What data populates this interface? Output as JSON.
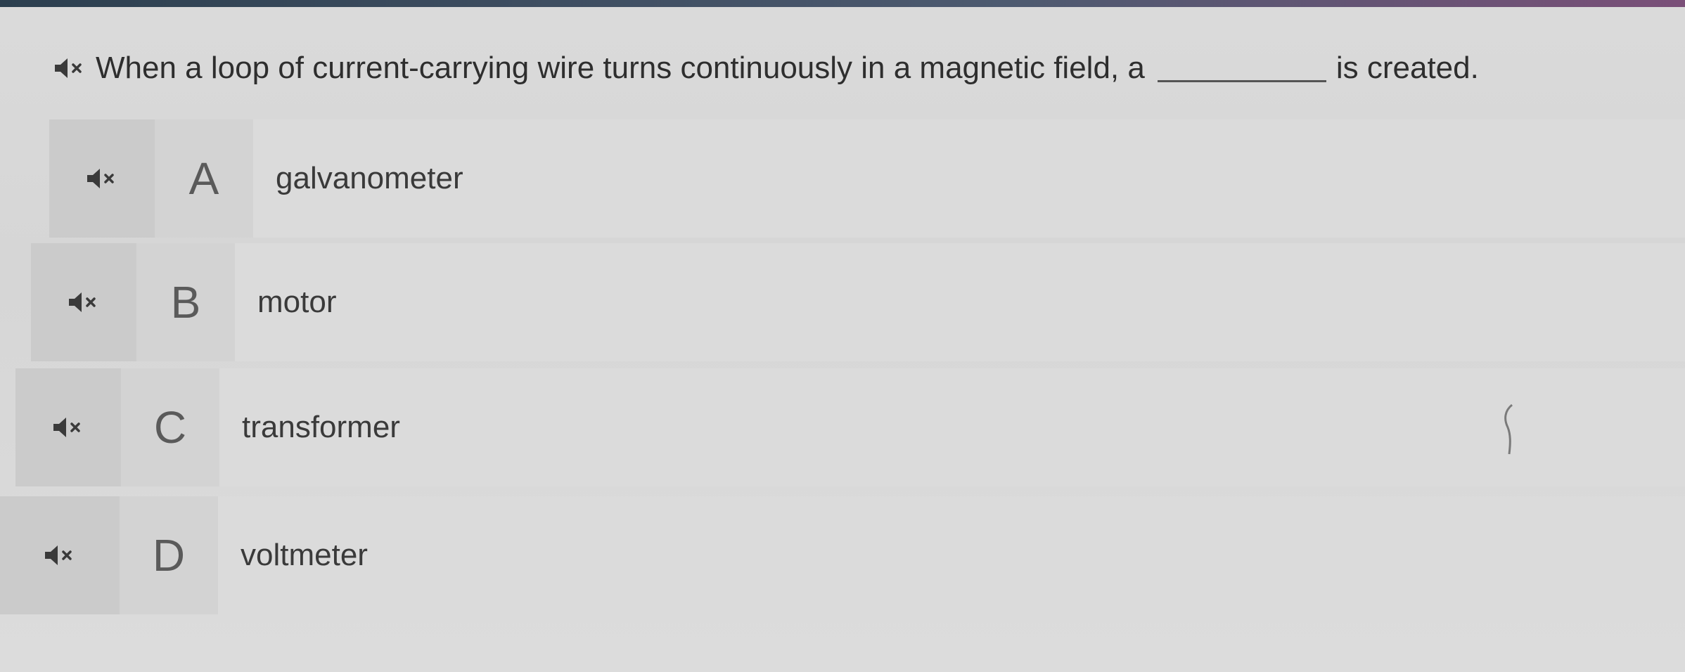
{
  "question": {
    "text_before": "When a loop of current-carrying wire turns continuously in a magnetic field, a",
    "text_after": "is created.",
    "audio_icon": "speaker-muted-icon"
  },
  "options": [
    {
      "letter": "A",
      "label": "galvanometer",
      "audio_icon": "speaker-muted-icon"
    },
    {
      "letter": "B",
      "label": "motor",
      "audio_icon": "speaker-muted-icon"
    },
    {
      "letter": "C",
      "label": "transformer",
      "audio_icon": "speaker-muted-icon"
    },
    {
      "letter": "D",
      "label": "voltmeter",
      "audio_icon": "speaker-muted-icon"
    }
  ],
  "colors": {
    "text": "#2e2e2e",
    "letter": "#5a5a5a",
    "audio_cell": "#cbcbcb",
    "option_bg": "#dbdbdb"
  }
}
